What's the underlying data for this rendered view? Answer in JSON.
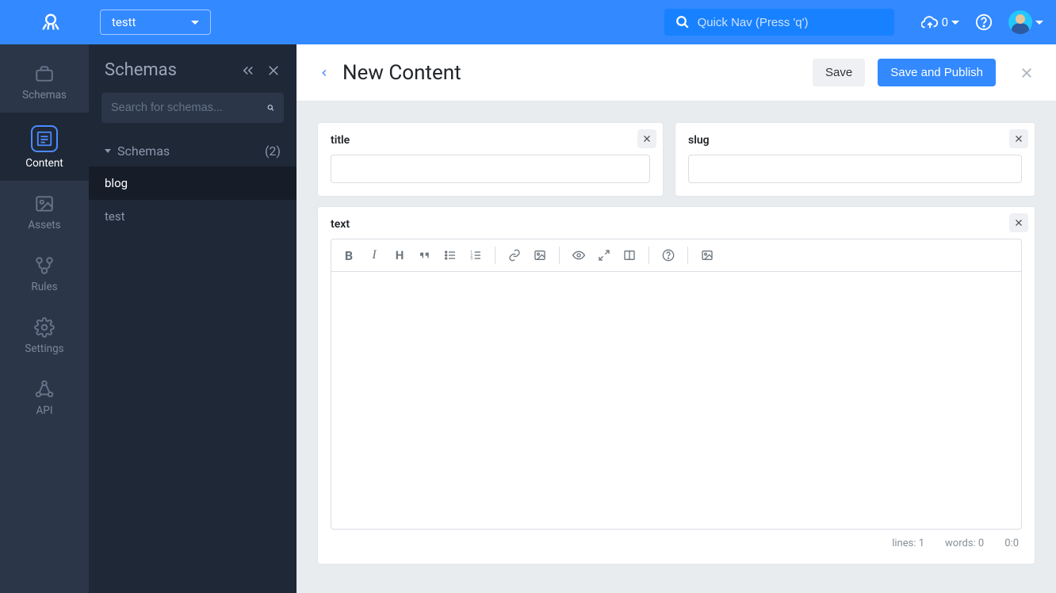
{
  "header": {
    "app_name": "testt",
    "quicknav_placeholder": "Quick Nav (Press 'q')",
    "cloud_count": "0"
  },
  "rail": {
    "items": [
      {
        "key": "schemas",
        "label": "Schemas"
      },
      {
        "key": "content",
        "label": "Content"
      },
      {
        "key": "assets",
        "label": "Assets"
      },
      {
        "key": "rules",
        "label": "Rules"
      },
      {
        "key": "settings",
        "label": "Settings"
      },
      {
        "key": "api",
        "label": "API"
      }
    ]
  },
  "panel2": {
    "title": "Schemas",
    "search_placeholder": "Search for schemas...",
    "group_label": "Schemas",
    "group_count": "(2)",
    "items": [
      {
        "name": "blog"
      },
      {
        "name": "test"
      }
    ]
  },
  "content": {
    "title": "New Content",
    "save_label": "Save",
    "publish_label": "Save and Publish",
    "fields": {
      "title_label": "title",
      "title_value": "",
      "slug_label": "slug",
      "slug_value": "",
      "text_label": "text"
    },
    "editor_status": {
      "lines_label": "lines: 1",
      "words_label": "words: 0",
      "pos_label": "0:0"
    }
  }
}
